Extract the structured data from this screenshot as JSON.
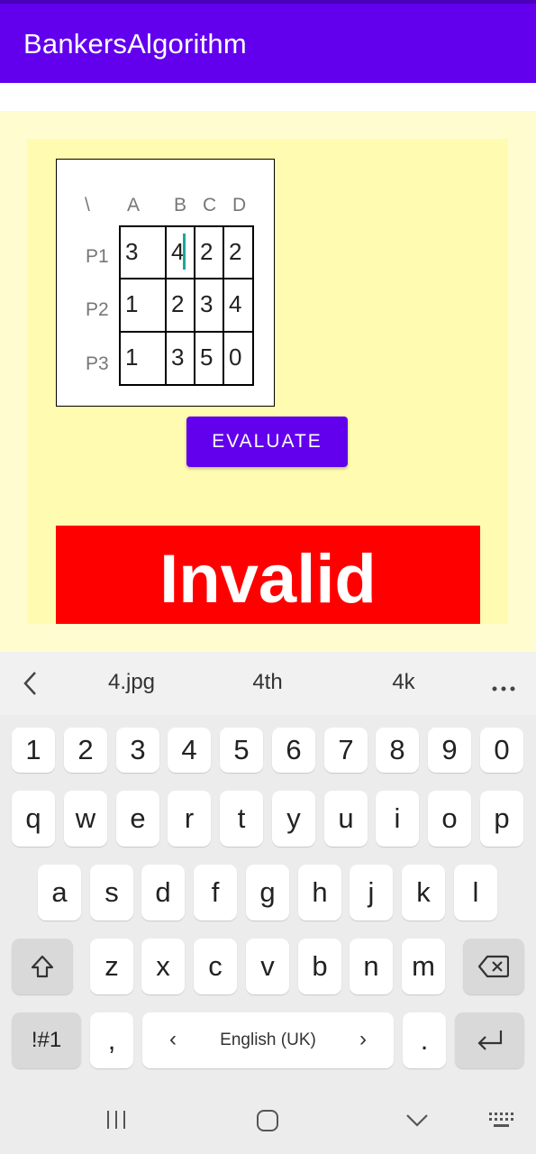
{
  "app": {
    "title": "BankersAlgorithm"
  },
  "matrix": {
    "corner": "\\",
    "columns": [
      "A",
      "B",
      "C",
      "D"
    ],
    "rows": [
      {
        "label": "P1",
        "values": [
          "3",
          "4",
          "2",
          "2"
        ]
      },
      {
        "label": "P2",
        "values": [
          "1",
          "2",
          "3",
          "4"
        ]
      },
      {
        "label": "P3",
        "values": [
          "1",
          "3",
          "5",
          "0"
        ]
      }
    ]
  },
  "evaluate_label": "EVALUATE",
  "result": {
    "text": "Invalid",
    "color": "#ff0000"
  },
  "keyboard": {
    "suggestions": [
      "4.jpg",
      "4th",
      "4k"
    ],
    "row1": [
      "1",
      "2",
      "3",
      "4",
      "5",
      "6",
      "7",
      "8",
      "9",
      "0"
    ],
    "row2": [
      "q",
      "w",
      "e",
      "r",
      "t",
      "y",
      "u",
      "i",
      "o",
      "p"
    ],
    "row3": [
      "a",
      "s",
      "d",
      "f",
      "g",
      "h",
      "j",
      "k",
      "l"
    ],
    "row4": [
      "z",
      "x",
      "c",
      "v",
      "b",
      "n",
      "m"
    ],
    "symbols_label": "!#1",
    "comma_label": ",",
    "space_label": "English (UK)",
    "period_label": "."
  },
  "colors": {
    "app_bar": "#6200ee",
    "accent": "#6200ee",
    "panel": "#fffbb0"
  },
  "icons": [
    "chevron-left-icon",
    "more-icon",
    "shift-icon",
    "backspace-icon",
    "enter-icon",
    "recents-icon",
    "home-icon",
    "back-icon",
    "keyboard-icon"
  ]
}
